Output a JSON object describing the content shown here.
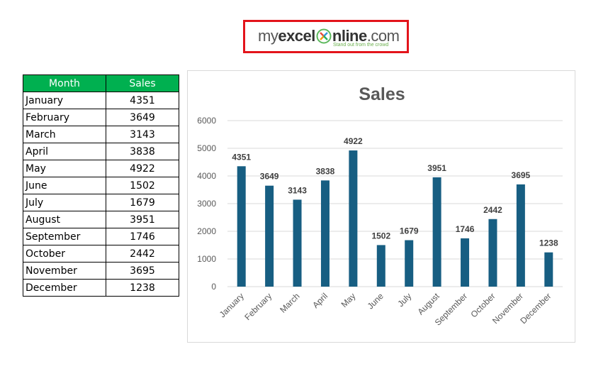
{
  "logo": {
    "part1": "my",
    "part2": "excel",
    "part3": "nline",
    "part4": ".com",
    "tagline": "Stand out from the crowd",
    "border_color": "#e3141b"
  },
  "table": {
    "headers": [
      "Month",
      "Sales"
    ],
    "header_bg": "#00b050",
    "rows": [
      {
        "month": "January",
        "sales": "4351"
      },
      {
        "month": "February",
        "sales": "3649"
      },
      {
        "month": "March",
        "sales": "3143"
      },
      {
        "month": "April",
        "sales": "3838"
      },
      {
        "month": "May",
        "sales": "4922"
      },
      {
        "month": "June",
        "sales": "1502"
      },
      {
        "month": "July",
        "sales": "1679"
      },
      {
        "month": "August",
        "sales": "3951"
      },
      {
        "month": "September",
        "sales": "1746"
      },
      {
        "month": "October",
        "sales": "2442"
      },
      {
        "month": "November",
        "sales": "3695"
      },
      {
        "month": "December",
        "sales": "1238"
      }
    ]
  },
  "chart_data": {
    "type": "bar",
    "title": "Sales",
    "xlabel": "",
    "ylabel": "",
    "categories": [
      "January",
      "February",
      "March",
      "April",
      "May",
      "June",
      "July",
      "August",
      "September",
      "October",
      "November",
      "December"
    ],
    "values": [
      4351,
      3649,
      3143,
      3838,
      4922,
      1502,
      1679,
      3951,
      1746,
      2442,
      3695,
      1238
    ],
    "ylim": [
      0,
      6000
    ],
    "yticks": [
      0,
      1000,
      2000,
      3000,
      4000,
      5000,
      6000
    ],
    "grid": true,
    "legend": "none",
    "data_labels": true,
    "bar_color": "#175e82"
  }
}
